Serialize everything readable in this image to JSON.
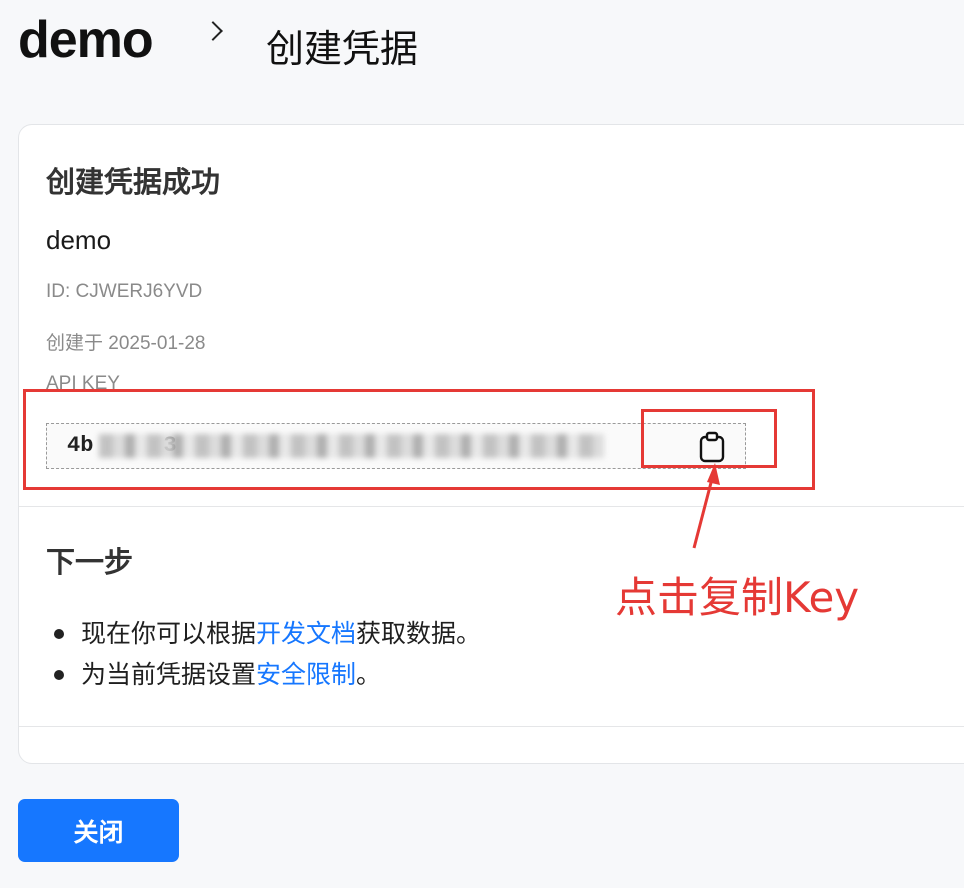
{
  "breadcrumb": {
    "root": "demo",
    "current": "创建凭据"
  },
  "card": {
    "title": "创建凭据成功",
    "credential_name": "demo",
    "id_text": "ID: CJWERJ6YVD",
    "created_text": "创建于 2025-01-28",
    "api_key_label": "API KEY",
    "api_key_visible_prefix": "4b",
    "api_key_visible_char": "3"
  },
  "next_steps": {
    "title": "下一步",
    "item1_before": "现在你可以根据",
    "item1_link": "开发文档",
    "item1_after": "获取数据。",
    "item2_before": "为当前凭据设置",
    "item2_link": "安全限制",
    "item2_after": "。"
  },
  "footer": {
    "close_label": "关闭"
  },
  "annotation": {
    "text": "点击复制Key",
    "color": "#e53935"
  },
  "colors": {
    "primary": "#1677ff",
    "annotation": "#e53935"
  },
  "icons": {
    "copy": "clipboard-icon",
    "breadcrumb_separator": "chevron-right-icon"
  }
}
